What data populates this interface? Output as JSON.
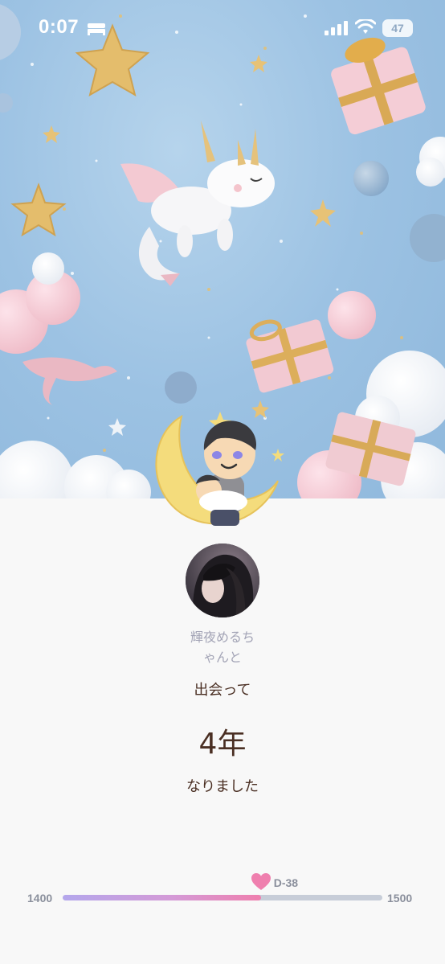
{
  "status_bar": {
    "time": "0:07",
    "battery": "47",
    "icons": [
      "bed-icon",
      "signal-icon",
      "wifi-icon",
      "battery-icon"
    ]
  },
  "profile": {
    "name_line1": "輝夜めるち",
    "name_line2": "ゃんと"
  },
  "anniversary": {
    "met_label": "出会って",
    "years": "4年",
    "became_label": "なりました"
  },
  "progress": {
    "min": "1400",
    "max": "1500",
    "days_left": "D-38",
    "fraction": 0.62
  },
  "colors": {
    "accent_pink": "#ef7fae",
    "accent_purple": "#b4a7ec",
    "text_brown": "#4a2f23",
    "name_gray": "#a3a4b6",
    "sky_blue": "#9cc2e3"
  }
}
